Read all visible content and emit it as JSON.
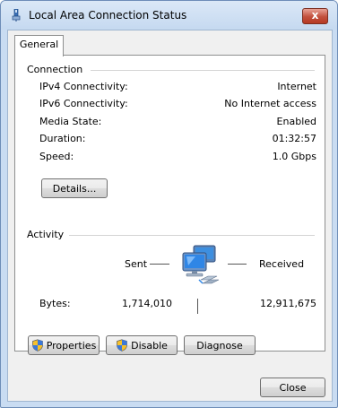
{
  "window": {
    "title": "Local Area Connection Status",
    "close_glyph": "x"
  },
  "tabs": [
    {
      "label": "General",
      "selected": true
    }
  ],
  "connection": {
    "label": "Connection",
    "rows": [
      {
        "label": "IPv4 Connectivity:",
        "value": "Internet"
      },
      {
        "label": "IPv6 Connectivity:",
        "value": "No Internet access"
      },
      {
        "label": "Media State:",
        "value": "Enabled"
      },
      {
        "label": "Duration:",
        "value": "01:32:57"
      },
      {
        "label": "Speed:",
        "value": "1.0 Gbps"
      }
    ],
    "details_button": "Details..."
  },
  "activity": {
    "label": "Activity",
    "sent_label": "Sent",
    "received_label": "Received",
    "bytes_label": "Bytes:",
    "bytes_sent": "1,714,010",
    "bytes_received": "12,911,675"
  },
  "actions": {
    "properties": "Properties",
    "disable": "Disable",
    "diagnose": "Diagnose"
  },
  "footer": {
    "close": "Close"
  }
}
